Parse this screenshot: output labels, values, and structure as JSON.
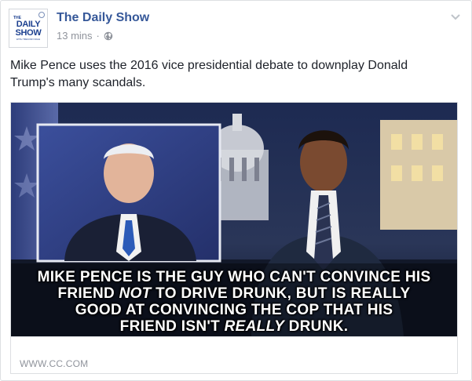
{
  "post": {
    "page_name": "The Daily Show",
    "timestamp": "13 mins",
    "separator": "·",
    "privacy_icon": "globe-icon",
    "menu_icon": "chevron-down-icon",
    "text_line1": "Mike Pence uses the 2016 vice presidential debate to downplay Donald",
    "text_line2": "Trump's many scandals."
  },
  "avatar": {
    "logo_the": "THE",
    "logo_daily": "DAILY",
    "logo_show": "SHOW",
    "logo_sub": "WITH TREVOR NOAH"
  },
  "shared_link": {
    "image_caption": {
      "line1": "MIKE PENCE IS THE GUY WHO CAN'T CONVINCE HIS",
      "line2a": "FRIEND ",
      "line2b": "NOT",
      "line2c": " TO DRIVE DRUNK, BUT IS REALLY",
      "line3": "GOOD AT CONVINCING THE COP THAT HIS",
      "line4a": "FRIEND ISN'T ",
      "line4b": "REALLY",
      "line4c": " DRUNK."
    },
    "domain": "WWW.CC.COM"
  },
  "colors": {
    "link_blue": "#365899",
    "meta_gray": "#90949c",
    "logo_blue": "#1b3f8f"
  }
}
